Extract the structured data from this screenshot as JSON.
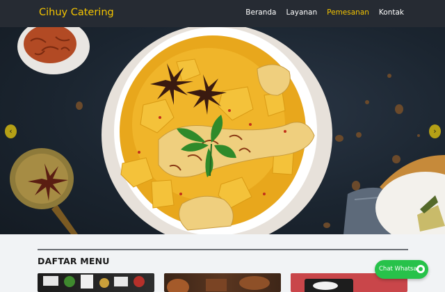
{
  "navbar": {
    "brand": "Cihuy Catering",
    "links": [
      {
        "label": "Beranda",
        "active": false
      },
      {
        "label": "Layanan",
        "active": false
      },
      {
        "label": "Pemesanan",
        "active": true
      },
      {
        "label": "Kontak",
        "active": false
      }
    ]
  },
  "carousel": {
    "prev_icon": "chevron-left-icon",
    "next_icon": "chevron-right-icon",
    "prev_symbol": "‹",
    "next_symbol": "›",
    "image": "curry-chicken-bowl-image"
  },
  "menu_section": {
    "title": "DAFTAR MENU"
  },
  "chat": {
    "label": "Chat Whatsapp",
    "icon": "whatsapp-icon"
  },
  "colors": {
    "navbar_bg": "#262b33",
    "brand": "#f4c400",
    "active_link": "#f4c400",
    "chat_green": "#27c24a"
  }
}
